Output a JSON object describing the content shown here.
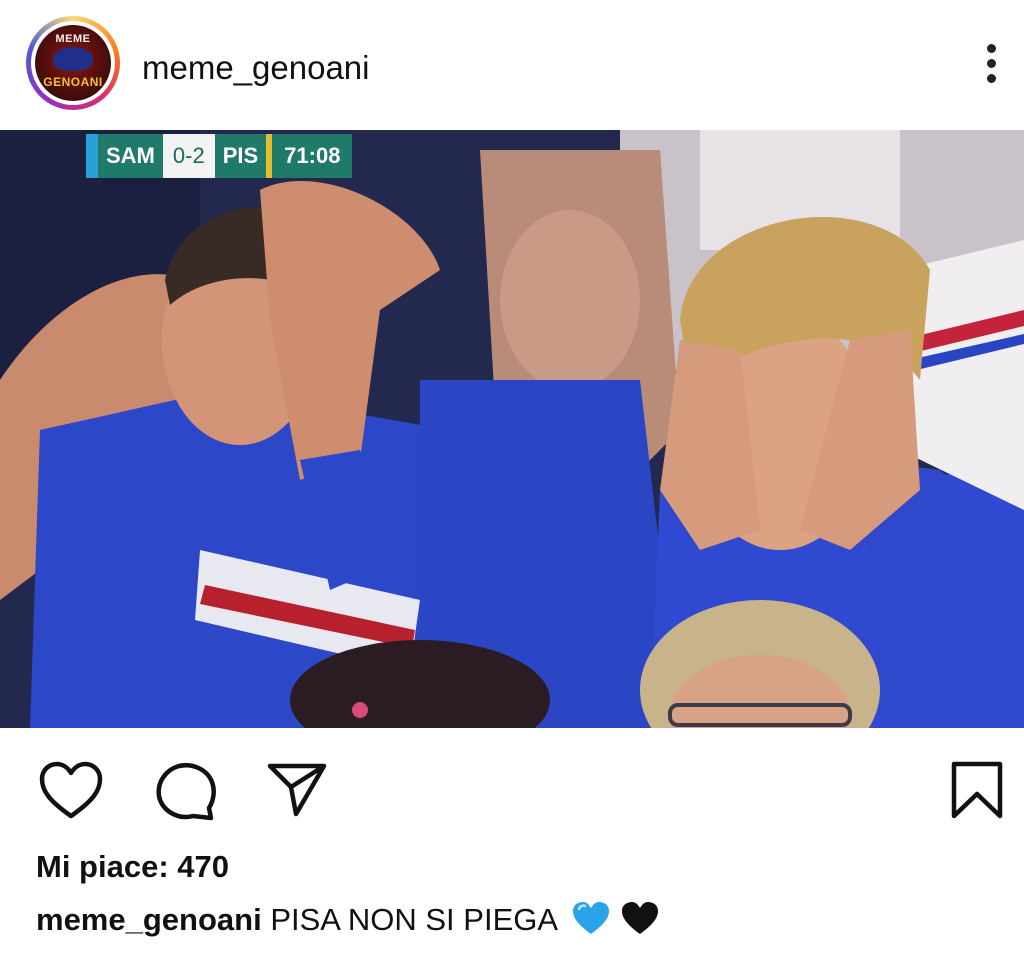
{
  "post": {
    "username": "meme_genoani",
    "avatar": {
      "text_top": "MEME",
      "text_bottom": "GENOANI"
    },
    "more_icon": "more-vertical-icon"
  },
  "photo": {
    "scoreboard": {
      "home": "SAM",
      "score": "0-2",
      "away": "PIS",
      "time": "71:08"
    }
  },
  "actions": {
    "like_icon": "heart-icon",
    "comment_icon": "comment-icon",
    "share_icon": "send-icon",
    "save_icon": "bookmark-icon"
  },
  "likes_label": "Mi piace: 470",
  "caption": {
    "username": "meme_genoani",
    "text": "PISA NON SI PIEGA",
    "emojis": [
      "blue-heart-icon",
      "black-heart-icon"
    ]
  },
  "colors": {
    "ring_start": "#feda75",
    "ring_end": "#962fbf",
    "blue_heart": "#2aa3e8",
    "scoreboard_green": "#1f7a6a"
  }
}
